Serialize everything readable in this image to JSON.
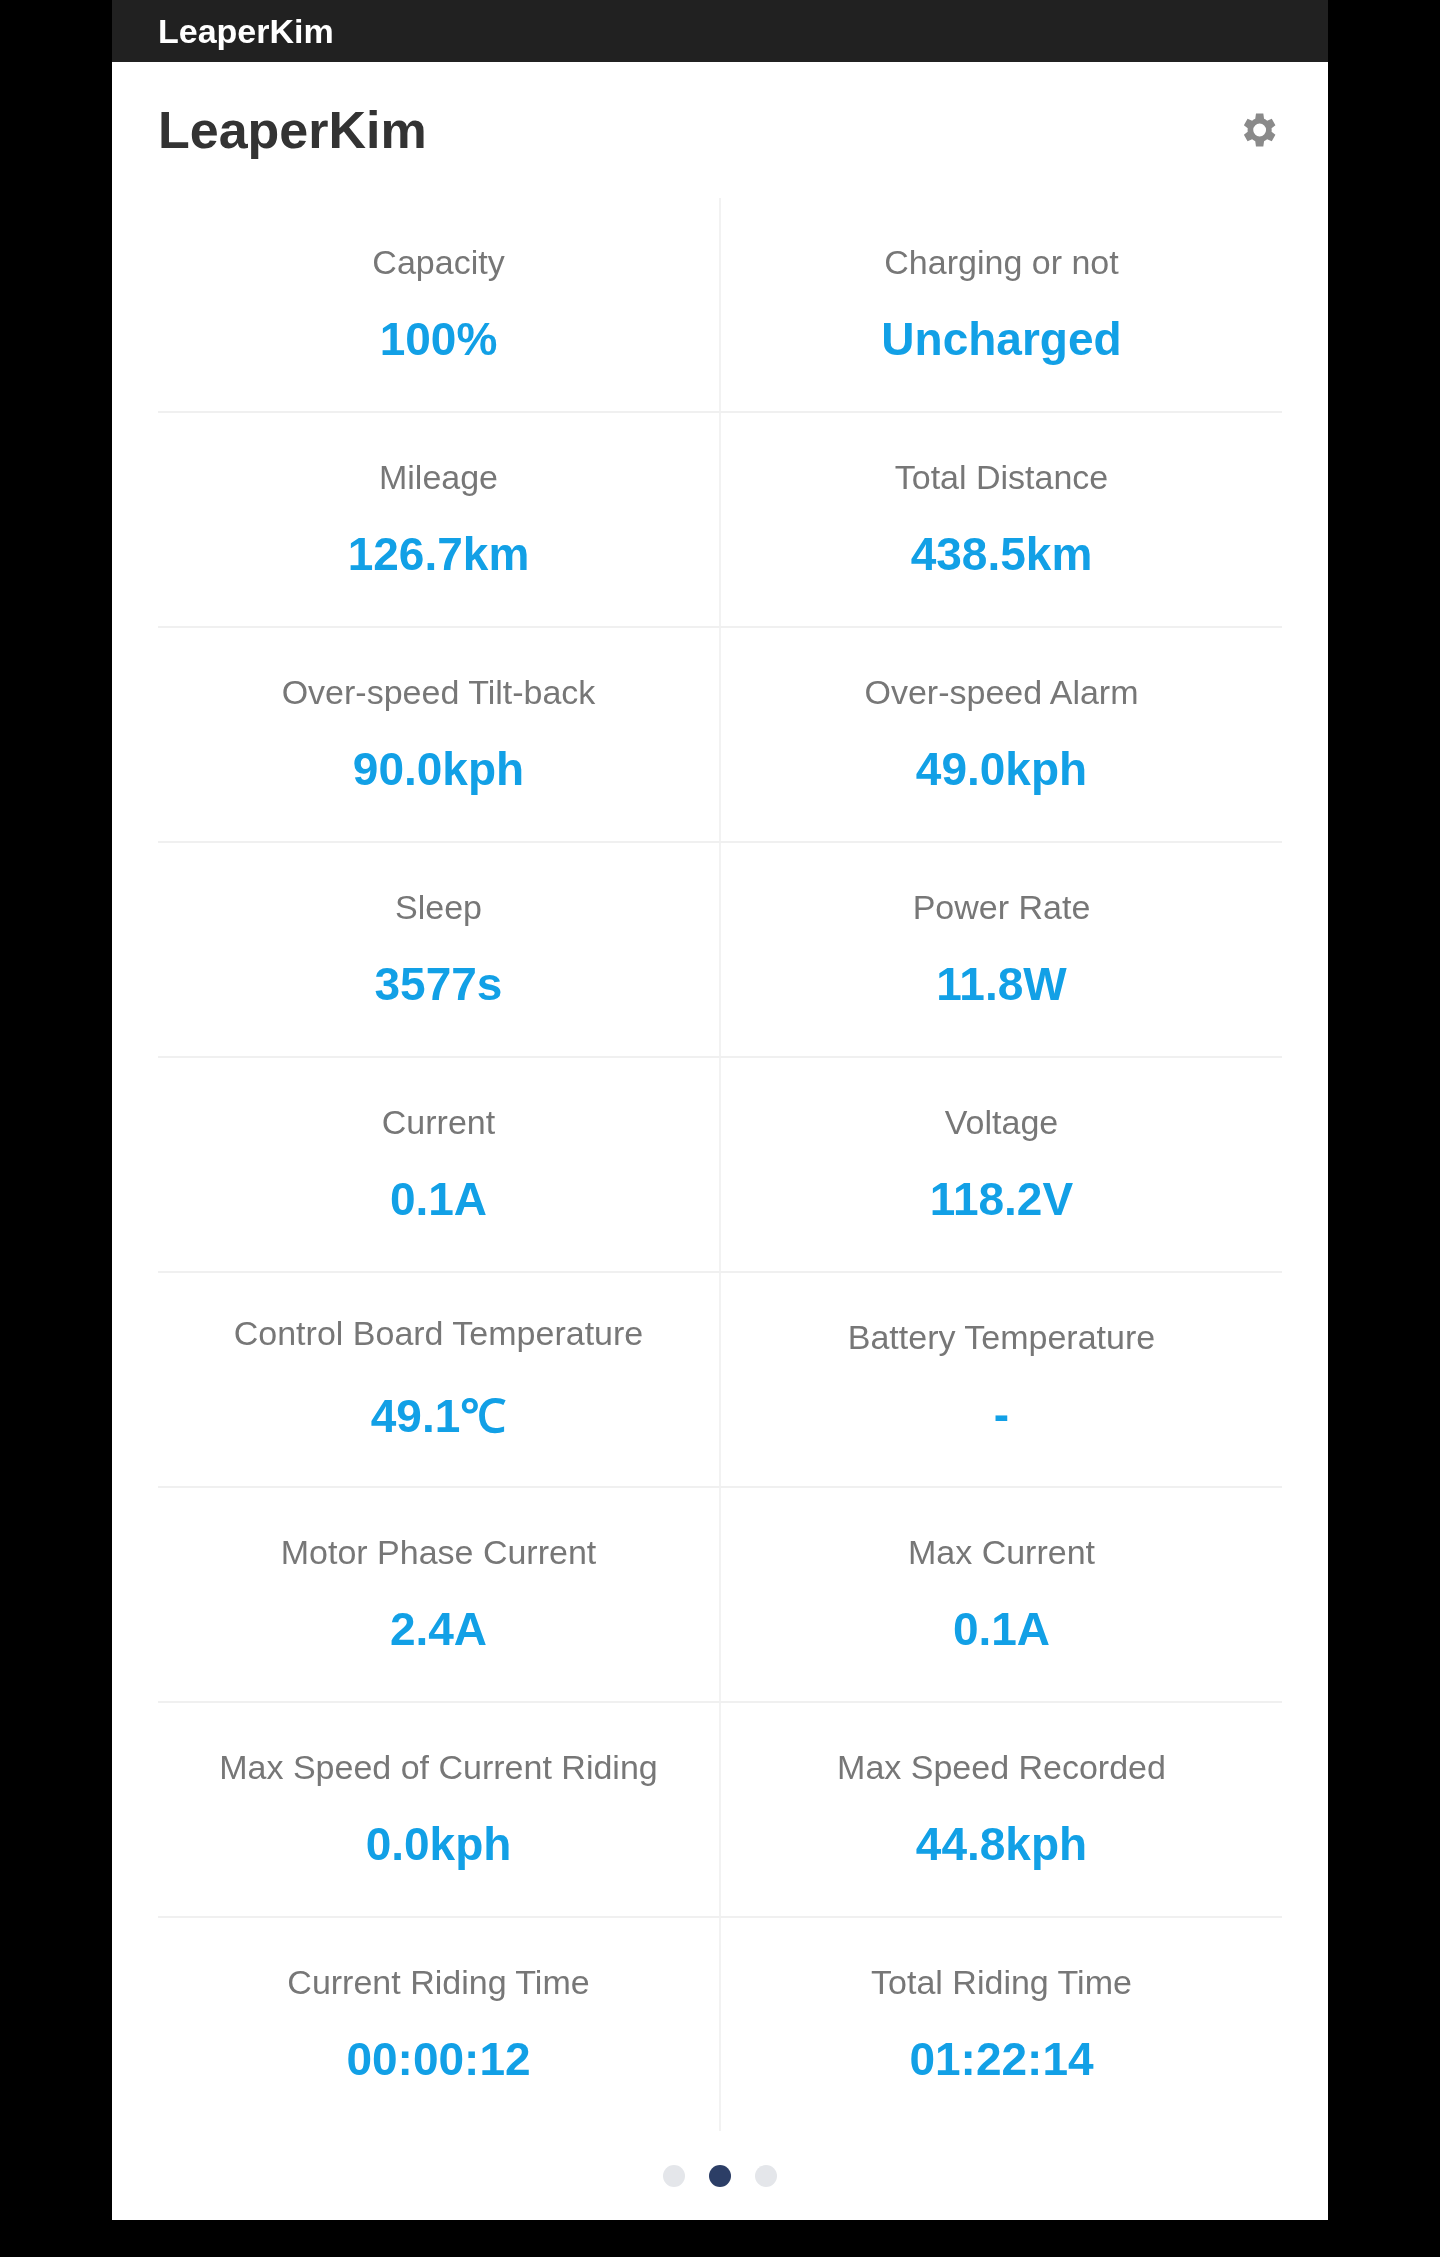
{
  "top_bar": {
    "title": "LeaperKim"
  },
  "card": {
    "title": "LeaperKim",
    "rows": [
      [
        {
          "label": "Capacity",
          "value": "100%"
        },
        {
          "label": "Charging or not",
          "value": "Uncharged"
        }
      ],
      [
        {
          "label": "Mileage",
          "value": "126.7km"
        },
        {
          "label": "Total Distance",
          "value": "438.5km"
        }
      ],
      [
        {
          "label": "Over-speed Tilt-back",
          "value": "90.0kph"
        },
        {
          "label": "Over-speed Alarm",
          "value": "49.0kph"
        }
      ],
      [
        {
          "label": "Sleep",
          "value": "3577s"
        },
        {
          "label": "Power Rate",
          "value": "11.8W"
        }
      ],
      [
        {
          "label": "Current",
          "value": "0.1A"
        },
        {
          "label": "Voltage",
          "value": "118.2V"
        }
      ],
      [
        {
          "label": "Control Board Temperature",
          "value": "49.1℃"
        },
        {
          "label": "Battery Temperature",
          "value": "-"
        }
      ],
      [
        {
          "label": "Motor Phase Current",
          "value": "2.4A"
        },
        {
          "label": "Max Current",
          "value": "0.1A"
        }
      ],
      [
        {
          "label": "Max Speed of Current Riding",
          "value": "0.0kph"
        },
        {
          "label": "Max Speed Recorded",
          "value": "44.8kph"
        }
      ],
      [
        {
          "label": "Current Riding Time",
          "value": "00:00:12"
        },
        {
          "label": "Total Riding Time",
          "value": "01:22:14"
        }
      ]
    ],
    "pages": [
      {
        "selected": false
      },
      {
        "selected": true
      },
      {
        "selected": false
      }
    ]
  }
}
